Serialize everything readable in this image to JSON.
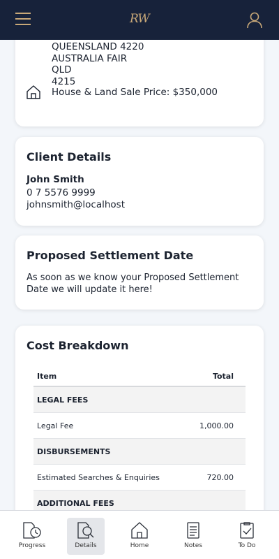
{
  "header": {
    "logo": "RW",
    "menu_icon": "hamburger-menu-icon",
    "profile_icon": "user-icon"
  },
  "property": {
    "address_lines": [
      "QUEENSLAND 4220",
      "AUSTRALIA FAIR",
      "QLD",
      "4215"
    ],
    "price_label": "House & Land Sale Price: $350,000"
  },
  "client": {
    "title": "Client Details",
    "name": "John Smith",
    "phone": "0 7 5576 9999",
    "email": "johnsmith@localhost"
  },
  "settlement": {
    "title": "Proposed Settlement Date",
    "text": "As soon as we know your Proposed Settlement Date we will update it here!"
  },
  "cost": {
    "title": "Cost Breakdown",
    "headers": {
      "item": "Item",
      "total": "Total"
    },
    "legal_fees": "LEGAL FEES",
    "legal_fee": {
      "item": "Legal Fee",
      "total": "1,000.00"
    },
    "disbursements": "DISBURSEMENTS",
    "searches": {
      "item": "Estimated Searches & Enquiries",
      "total": "720.00"
    },
    "additional_fees": "ADDITIONAL FEES"
  },
  "nav": {
    "progress": "Progress",
    "details": "Details",
    "home": "Home",
    "notes": "Notes",
    "todo": "To Do",
    "active": "Details"
  },
  "colors": {
    "header_bg": "#17223a",
    "accent_gold": "#c8a878"
  }
}
